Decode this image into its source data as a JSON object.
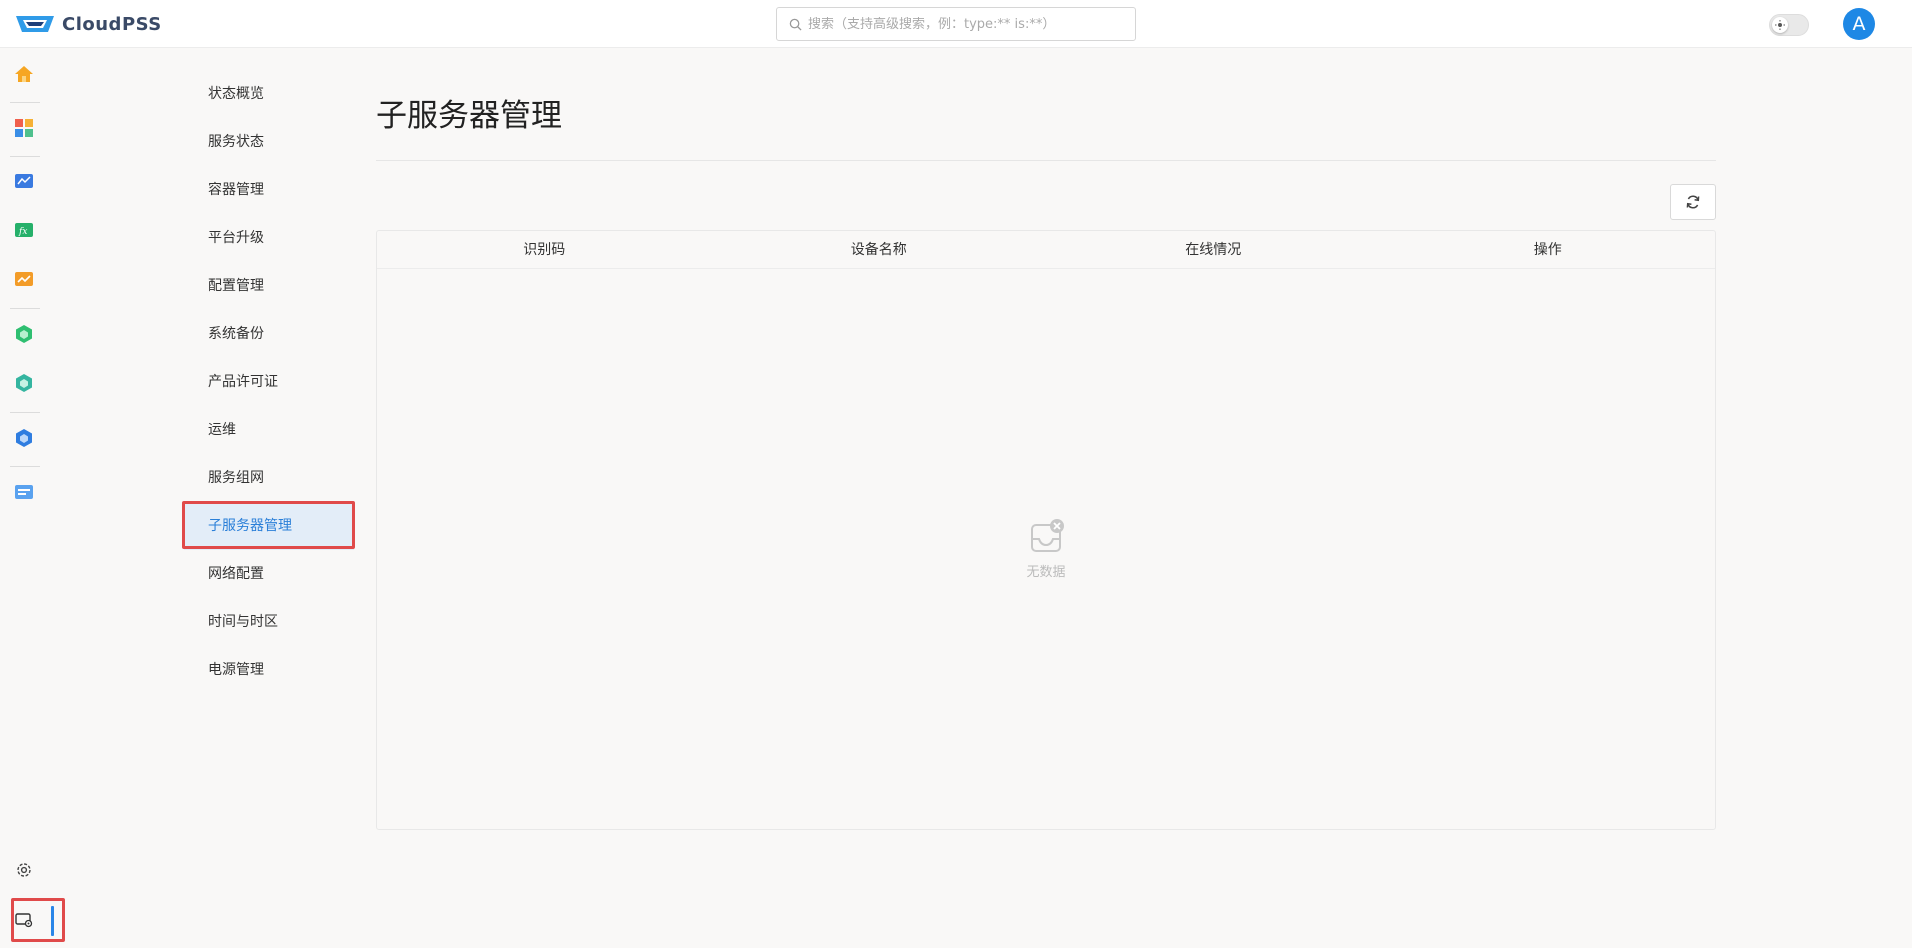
{
  "header": {
    "logo_text": "CloudPSS",
    "search_placeholder": "搜索（支持高级搜索，例：type:** is:**）",
    "avatar_letter": "A"
  },
  "rail": {
    "icons": [
      "home-icon",
      "apps-icon",
      "monitor-icon",
      "function-icon",
      "chart-icon",
      "cube-green-icon",
      "cube-green-icon",
      "cube-blue-icon",
      "document-icon",
      "settings-icon",
      "system-admin-icon"
    ]
  },
  "subnav": {
    "items": [
      "状态概览",
      "服务状态",
      "容器管理",
      "平台升级",
      "配置管理",
      "系统备份",
      "产品许可证",
      "运维",
      "服务组网",
      "子服务器管理",
      "网络配置",
      "时间与时区",
      "电源管理"
    ],
    "active": "子服务器管理"
  },
  "main": {
    "title": "子服务器管理",
    "table": {
      "columns": [
        "识别码",
        "设备名称",
        "在线情况",
        "操作"
      ],
      "rows": [],
      "empty_text": "无数据"
    }
  },
  "colors": {
    "accent": "#2a86e8",
    "highlight": "#e04a4a",
    "active_bg": "#e3edf8"
  }
}
